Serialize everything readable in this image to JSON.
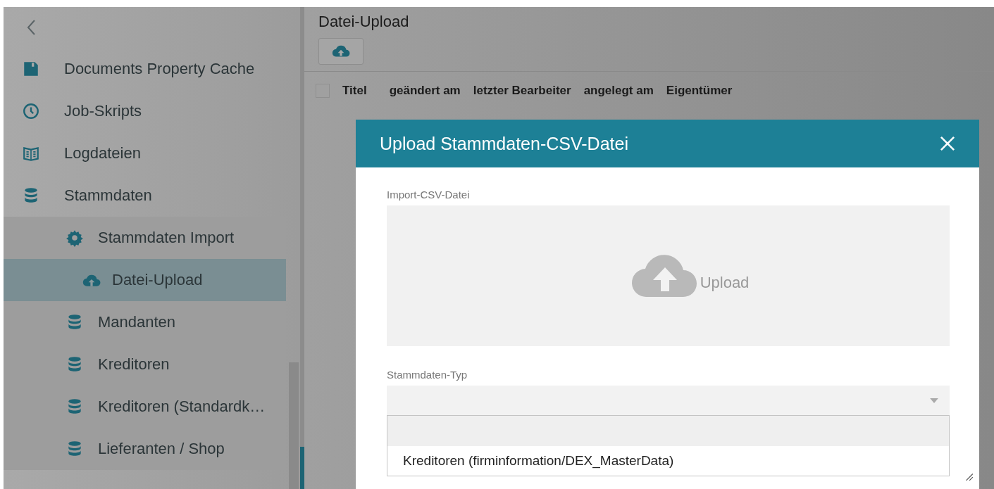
{
  "sidebar": {
    "items": [
      {
        "label": "Documents Property Cache",
        "kind": "save",
        "selected": false
      },
      {
        "label": "Job-Skripts",
        "kind": "clock",
        "selected": false
      },
      {
        "label": "Logdateien",
        "kind": "book",
        "selected": false
      },
      {
        "label": "Stammdaten",
        "kind": "database",
        "selected": false,
        "children": [
          {
            "label": "Stammdaten Import",
            "kind": "gear",
            "selected": false,
            "children": [
              {
                "label": "Datei-Upload",
                "kind": "cloud",
                "selected": true
              }
            ]
          },
          {
            "label": "Mandanten",
            "kind": "database",
            "selected": false
          },
          {
            "label": "Kreditoren",
            "kind": "database",
            "selected": false
          },
          {
            "label": "Kreditoren (Standardk…",
            "kind": "database",
            "selected": false
          },
          {
            "label": "Lieferanten / Shop",
            "kind": "database",
            "selected": false
          }
        ]
      }
    ]
  },
  "main": {
    "title": "Datei-Upload",
    "columns": [
      "Titel",
      "geändert am",
      "letzter Bearbeiter",
      "angelegt am",
      "Eigentümer"
    ],
    "select_all_checked": false
  },
  "dialog": {
    "title": "Upload Stammdaten-CSV-Datei",
    "file_label": "Import-CSV-Datei",
    "drop_zone_text": "Upload",
    "type_label": "Stammdaten-Typ",
    "dropdown": {
      "expanded": true,
      "empty_option_highlighted": true,
      "options": [
        {
          "label": "Kreditoren (firminformation/DEX_MasterData)",
          "selected": false
        }
      ]
    }
  }
}
